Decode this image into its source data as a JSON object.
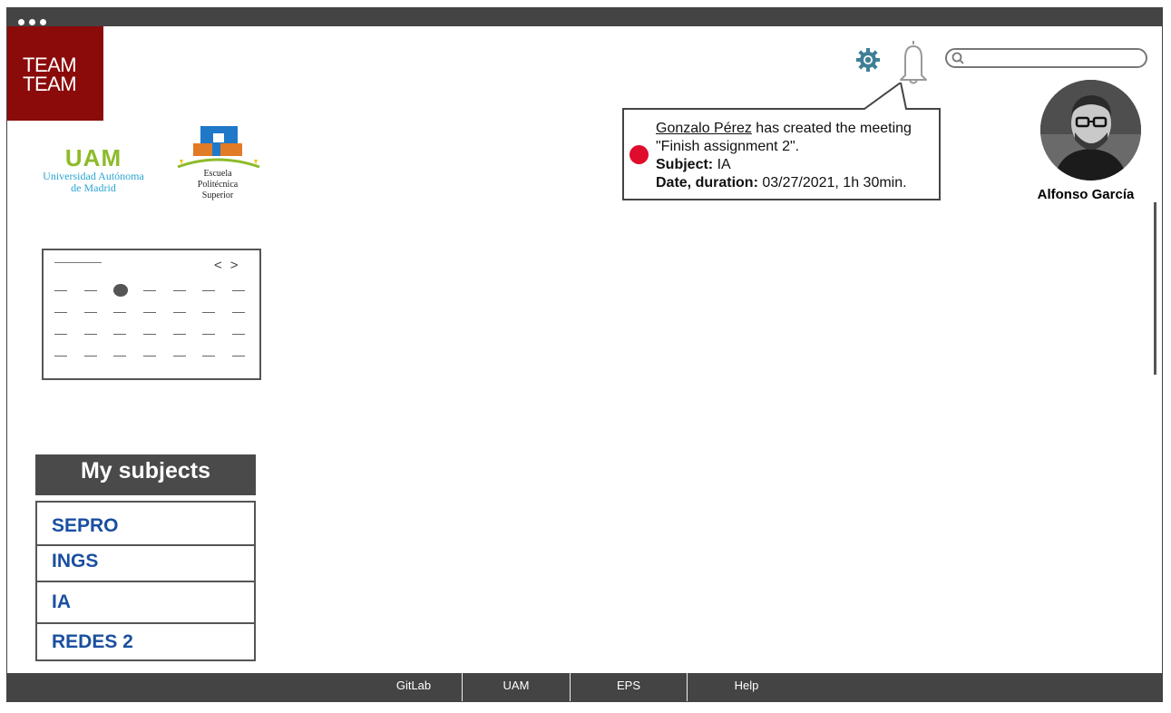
{
  "brand": {
    "line1": "TEAM",
    "line2": "TEAM",
    "color": "#8b0a0a"
  },
  "logos": {
    "uam_mark": "UAM",
    "uam_line1": "Universidad Autónoma",
    "uam_line2": "de Madrid",
    "eps_line1": "Escuela",
    "eps_line2": "Politécnica",
    "eps_line3": "Superior"
  },
  "header": {
    "search": {
      "value": "",
      "placeholder": ""
    },
    "icons": [
      "gear-icon",
      "bell-icon",
      "search-icon"
    ]
  },
  "notification": {
    "author": "Gonzalo Pérez",
    "action": " has created the meeting \"Finish assignment 2\".",
    "subject_label": "Subject:",
    "subject_value": " IA",
    "date_label": "Date, duration:",
    "date_value": " 03/27/2021, 1h 30min.",
    "dot_color": "#e00c2b"
  },
  "user": {
    "name": "Alfonso García"
  },
  "calendar": {
    "prev": "<",
    "next": ">"
  },
  "subjects": {
    "title": "My subjects",
    "items": [
      "SEPRO",
      "INGS",
      "IA",
      "REDES 2"
    ]
  },
  "footer": {
    "links": [
      "GitLab",
      "UAM",
      "EPS",
      "Help"
    ]
  },
  "colors": {
    "subject_link": "#1a4fa0",
    "chrome": "#444444"
  }
}
